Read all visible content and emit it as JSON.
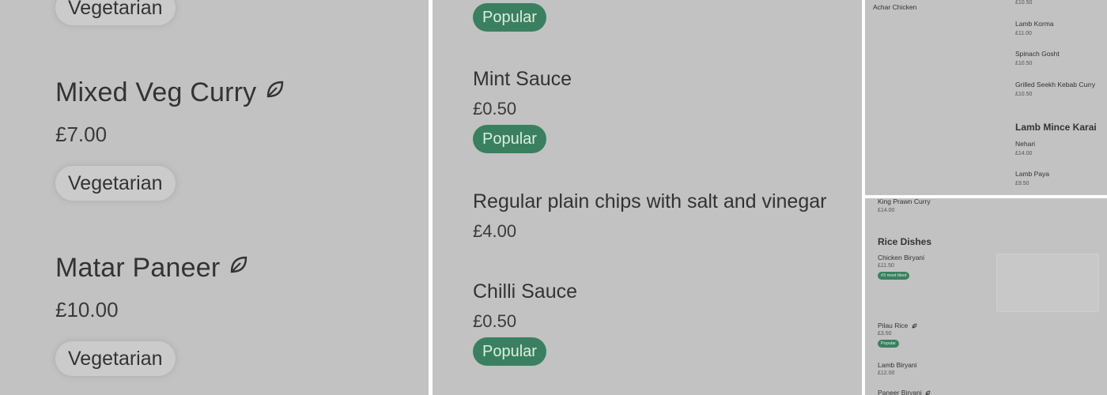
{
  "panel1": {
    "top_tag": "Vegetarian",
    "items": [
      {
        "name": "Mixed Veg Curry",
        "price": "£7.00",
        "tag": "Vegetarian"
      },
      {
        "name": "Matar Paneer",
        "price": "£10.00",
        "tag": "Vegetarian"
      }
    ]
  },
  "panel2": {
    "top_badge": "Popular",
    "items": [
      {
        "name": "Mint Sauce",
        "price": "£0.50",
        "badge": "Popular"
      },
      {
        "name": "Regular plain chips with salt and vinegar",
        "price": "£4.00"
      },
      {
        "name": "Chilli Sauce",
        "price": "£0.50",
        "badge": "Popular"
      }
    ]
  },
  "panel3": {
    "left_item": "Achar Chicken",
    "top_price": "£10.50",
    "items": [
      {
        "name": "Lamb Korma",
        "price": "£11.00"
      },
      {
        "name": "Spinach Gosht",
        "price": "£10.50"
      },
      {
        "name": "Grilled Seekh Kebab Curry",
        "price": "£10.50"
      }
    ],
    "section": "Lamb Mince Karai",
    "items2": [
      {
        "name": "Nehari",
        "price": "£14.00"
      },
      {
        "name": "Lamb Paya",
        "price": "£9.50"
      }
    ]
  },
  "panel4": {
    "top_item": {
      "name": "King Prawn Curry",
      "price": "£14.00"
    },
    "section": "Rice Dishes",
    "items": [
      {
        "name": "Chicken Biryani",
        "price": "£11.50",
        "badge": "#3 most liked"
      },
      {
        "name": "Pilau Rice",
        "price": "£3.50",
        "badge": "Popular"
      },
      {
        "name": "Lamb Biryani",
        "price": "£12.00"
      },
      {
        "name": "Paneer Biryani"
      }
    ]
  },
  "colors": {
    "badge_green": "#3a8060",
    "panel_bg": "#c2c2c2"
  },
  "icons": {
    "vegetarian": "leaf-icon"
  }
}
